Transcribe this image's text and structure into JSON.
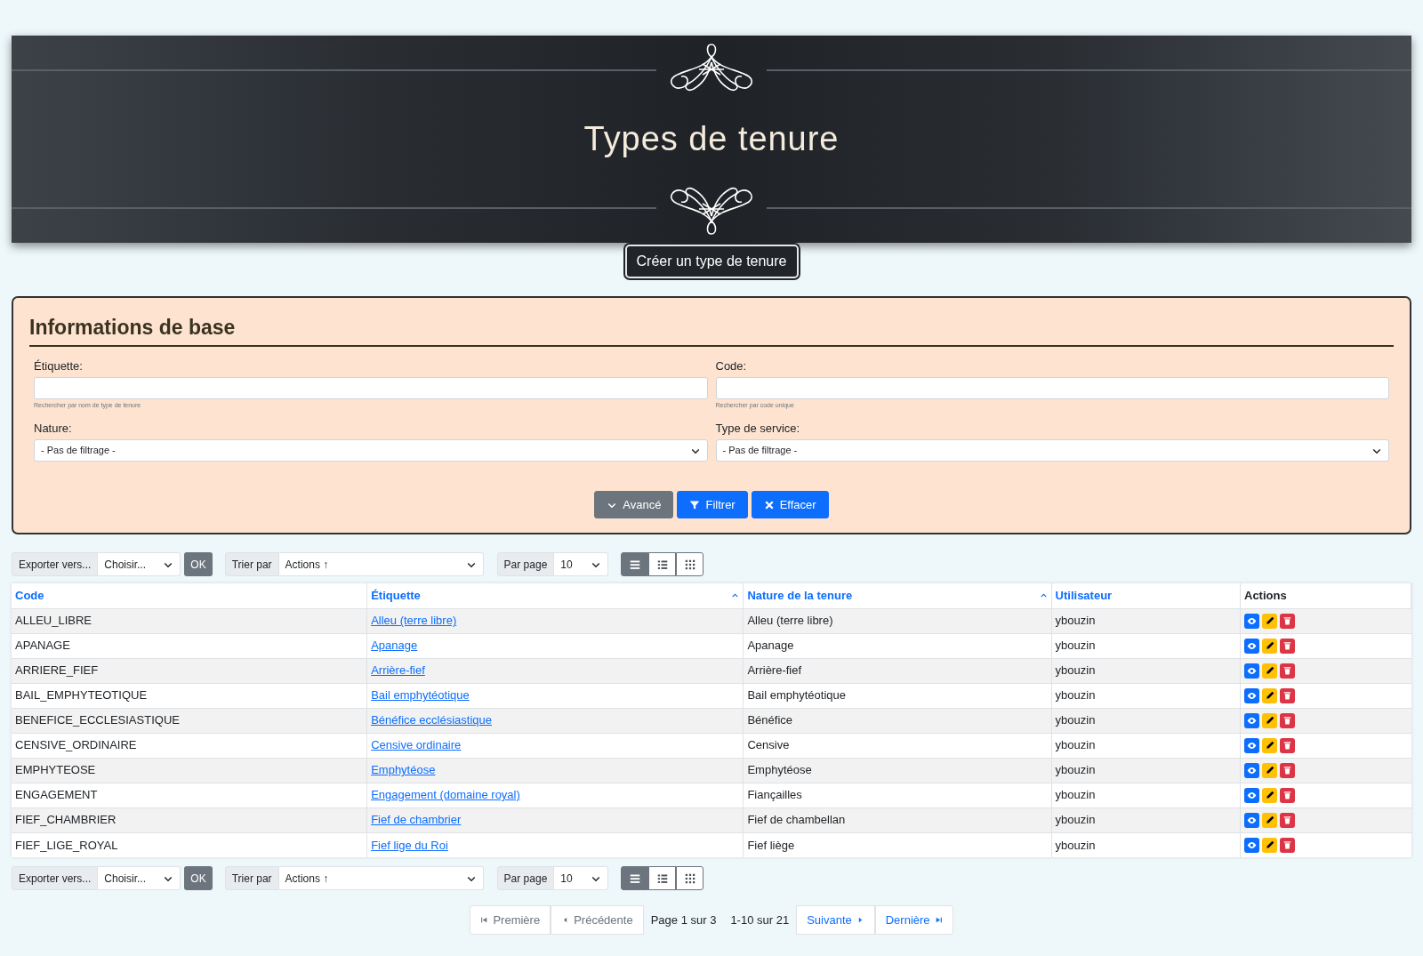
{
  "header": {
    "title": "Types de tenure",
    "create_button": "Créer un type de tenure"
  },
  "filter": {
    "title": "Informations de base",
    "fields": [
      {
        "kind": "text",
        "label": "Étiquette:",
        "hint": "Rechercher par nom de type de tenure"
      },
      {
        "kind": "text",
        "label": "Code:",
        "hint": "Rechercher par code unique"
      },
      {
        "kind": "select",
        "label": "Nature:",
        "value": "- Pas de filtrage -"
      },
      {
        "kind": "select",
        "label": "Type de service:",
        "value": "- Pas de filtrage -"
      }
    ],
    "buttons": [
      {
        "kind": "advanced",
        "label": "Avancé"
      },
      {
        "kind": "filter",
        "label": "Filtrer"
      },
      {
        "kind": "clear",
        "label": "Effacer"
      }
    ]
  },
  "toolbars": [
    {
      "export_label": "Exporter vers...",
      "export_value": "Choisir...",
      "ok": "OK",
      "sort_label": "Trier par",
      "sort_value": "Actions ↑",
      "per_page_label": "Par page",
      "per_page_value": "10",
      "views": [
        {
          "kind": "list",
          "selected": true
        },
        {
          "kind": "details",
          "selected": false
        },
        {
          "kind": "grid",
          "selected": false
        }
      ]
    },
    {
      "export_label": "Exporter vers...",
      "export_value": "Choisir...",
      "ok": "OK",
      "sort_label": "Trier par",
      "sort_value": "Actions ↑",
      "per_page_label": "Par page",
      "per_page_value": "10",
      "views": [
        {
          "kind": "list",
          "selected": true
        },
        {
          "kind": "details",
          "selected": false
        },
        {
          "kind": "grid",
          "selected": false
        }
      ]
    }
  ],
  "table": {
    "columns": [
      {
        "label": "Code",
        "link": true,
        "sorted": false
      },
      {
        "label": "Étiquette",
        "link": true,
        "sorted": true
      },
      {
        "label": "Nature de la tenure",
        "link": true,
        "sorted": true
      },
      {
        "label": "Utilisateur",
        "link": true,
        "sorted": false
      },
      {
        "label": "Actions",
        "link": false,
        "sorted": false
      }
    ],
    "rows": [
      {
        "code": "ALLEU_LIBRE",
        "label": "Alleu (terre libre)",
        "nature": "Alleu (terre libre)",
        "user": "ybouzin"
      },
      {
        "code": "APANAGE",
        "label": "Apanage",
        "nature": "Apanage",
        "user": "ybouzin"
      },
      {
        "code": "ARRIERE_FIEF",
        "label": "Arrière-fief",
        "nature": "Arrière-fief",
        "user": "ybouzin"
      },
      {
        "code": "BAIL_EMPHYTEOTIQUE",
        "label": "Bail emphytéotique",
        "nature": "Bail emphytéotique",
        "user": "ybouzin"
      },
      {
        "code": "BENEFICE_ECCLESIASTIQUE",
        "label": "Bénéfice ecclésiastique",
        "nature": "Bénéfice",
        "user": "ybouzin"
      },
      {
        "code": "CENSIVE_ORDINAIRE",
        "label": "Censive ordinaire",
        "nature": "Censive",
        "user": "ybouzin"
      },
      {
        "code": "EMPHYTEOSE",
        "label": "Emphytéose",
        "nature": "Emphytéose",
        "user": "ybouzin"
      },
      {
        "code": "ENGAGEMENT",
        "label": "Engagement (domaine royal)",
        "nature": "Fiançailles",
        "user": "ybouzin"
      },
      {
        "code": "FIEF_CHAMBRIER",
        "label": "Fief de chambrier",
        "nature": "Fief de chambellan",
        "user": "ybouzin"
      },
      {
        "code": "FIEF_LIGE_ROYAL",
        "label": "Fief lige du Roi",
        "nature": "Fief liège",
        "user": "ybouzin"
      }
    ]
  },
  "pagination": [
    {
      "kind": "first",
      "label": "Première",
      "disabled": true
    },
    {
      "kind": "prev",
      "label": "Précédente",
      "disabled": true
    },
    {
      "kind": "text",
      "label": "Page 1 sur 3"
    },
    {
      "kind": "text",
      "label": "1-10 sur 21"
    },
    {
      "kind": "next",
      "label": "Suivante",
      "disabled": false
    },
    {
      "kind": "last",
      "label": "Dernière",
      "disabled": false
    }
  ]
}
